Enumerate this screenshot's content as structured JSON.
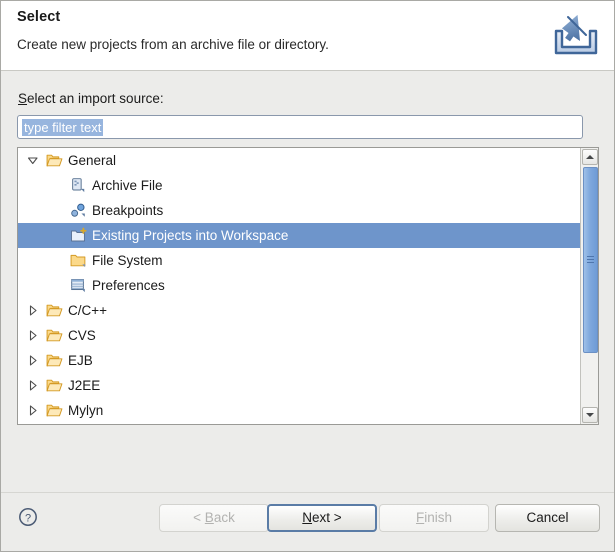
{
  "dialog": {
    "title": "Select",
    "description": "Create new projects from an archive file or directory.",
    "header_icon": "import-icon"
  },
  "source_section": {
    "label_prefix": "S",
    "label_rest": "elect an import source:",
    "filter": {
      "value": "type filter text",
      "placeholder": "type filter text",
      "selected": true
    }
  },
  "tree": {
    "rows": [
      {
        "label": "General",
        "level": 0,
        "expanded": true,
        "icon": "open-folder-icon",
        "selected": false
      },
      {
        "label": "Archive File",
        "level": 1,
        "expanded": null,
        "icon": "archive-file-icon",
        "selected": false
      },
      {
        "label": "Breakpoints",
        "level": 1,
        "expanded": null,
        "icon": "breakpoints-icon",
        "selected": false
      },
      {
        "label": "Existing Projects into Workspace",
        "level": 1,
        "expanded": null,
        "icon": "existing-projects-icon",
        "selected": true
      },
      {
        "label": "File System",
        "level": 1,
        "expanded": null,
        "icon": "folder-icon",
        "selected": false
      },
      {
        "label": "Preferences",
        "level": 1,
        "expanded": null,
        "icon": "preferences-icon",
        "selected": false
      },
      {
        "label": "C/C++",
        "level": 0,
        "expanded": false,
        "icon": "open-folder-icon",
        "selected": false
      },
      {
        "label": "CVS",
        "level": 0,
        "expanded": false,
        "icon": "open-folder-icon",
        "selected": false
      },
      {
        "label": "EJB",
        "level": 0,
        "expanded": false,
        "icon": "open-folder-icon",
        "selected": false
      },
      {
        "label": "J2EE",
        "level": 0,
        "expanded": false,
        "icon": "open-folder-icon",
        "selected": false
      },
      {
        "label": "Mylyn",
        "level": 0,
        "expanded": false,
        "icon": "open-folder-icon",
        "selected": false
      }
    ],
    "scrollbar": {
      "orientation": "vertical",
      "thumb_position_pct": 6,
      "thumb_size_pct": 68
    }
  },
  "buttons": {
    "help": "help-icon",
    "back": {
      "prefix": "< ",
      "mnemonic": "B",
      "suffix": "ack",
      "enabled": false,
      "default": false
    },
    "next": {
      "prefix": "",
      "mnemonic": "N",
      "suffix": "ext >",
      "enabled": true,
      "default": true
    },
    "finish": {
      "prefix": "",
      "mnemonic": "F",
      "suffix": "inish",
      "enabled": false,
      "default": false
    },
    "cancel": {
      "prefix": "",
      "mnemonic": "",
      "suffix": "Cancel",
      "enabled": true,
      "default": false
    }
  },
  "colors": {
    "selection_blue": "#6e95cb",
    "text_selection_blue": "#97b5de",
    "body_gray": "#ececea",
    "scroll_thumb": "#7fa8dd",
    "folder_amber": "#f5c96a"
  }
}
